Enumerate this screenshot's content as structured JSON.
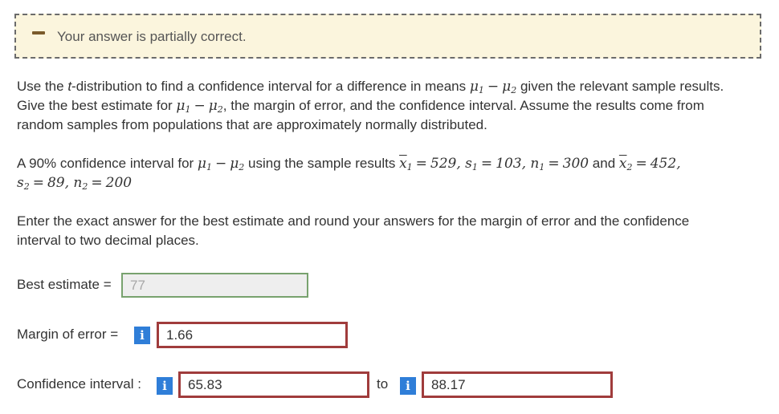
{
  "feedback": {
    "message": "Your answer is partially correct."
  },
  "problem": {
    "p1_a": "Use the ",
    "p1_t": "t",
    "p1_b": "-distribution to find a confidence interval for a difference in means ",
    "p1_c": " given the relevant sample results.",
    "p1_line2a": "Give the best estimate for ",
    "p1_line2b": ", the margin of error, and the confidence interval. Assume the results come from",
    "p1_line3": "random samples from populations that are approximately normally distributed.",
    "p2_a": "A 90% confidence interval for ",
    "p2_b": " using the sample results ",
    "p2_c": " and ",
    "x1": "529",
    "s1": "103",
    "n1": "300",
    "x2": "452",
    "s2": "89",
    "n2": "200",
    "instructions_line1": "Enter the exact answer for the best estimate and round your answers for the margin of error and the confidence",
    "instructions_line2": "interval to two decimal places."
  },
  "best_estimate": {
    "label": "Best estimate =",
    "value": "77"
  },
  "margin_of_error": {
    "label": "Margin of error =",
    "value": "1.66"
  },
  "confidence_interval": {
    "label": "Confidence interval :",
    "lower": "65.83",
    "to_label": "to",
    "upper": "88.17"
  },
  "info_icon_glyph": "i"
}
